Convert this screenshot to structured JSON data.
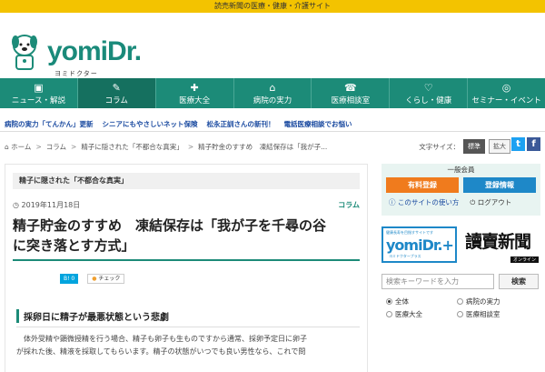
{
  "topbar": {
    "text": "読売新聞の医療・健康・介護サイト"
  },
  "logo": {
    "main": "yomi",
    "dr": "Dr.",
    "sub": "ヨミドクター"
  },
  "nav": [
    {
      "icon": "▣",
      "label": "ニュース・解説"
    },
    {
      "icon": "✎",
      "label": "コラム"
    },
    {
      "icon": "✚",
      "label": "医療大全"
    },
    {
      "icon": "⌂",
      "label": "病院の実力"
    },
    {
      "icon": "☎",
      "label": "医療相談室"
    },
    {
      "icon": "♡",
      "label": "くらし・健康"
    },
    {
      "icon": "◎",
      "label": "セミナー・イベント"
    }
  ],
  "subnav": [
    "病院の実力「てんかん」更新",
    "シニアにもやさしいネット保険",
    "松永正訓さんの新刊！",
    "電話医療相談でお悩い"
  ],
  "breadcrumb": [
    "ホーム",
    "コラム",
    "精子に隠された「不都合な真実」",
    "精子貯金のすすめ　凍結保存は「我が子..."
  ],
  "fontsize": {
    "label": "文字サイズ：",
    "standard": "標準",
    "large": "拡大"
  },
  "article": {
    "series": "精子に隠された「不都合な真実」",
    "date": "2019年11月18日",
    "category": "コラム",
    "title_line1": "精子貯金のすすめ　凍結保存は「我が子を千尋の谷",
    "title_line2": "に突き落とす方式」",
    "share_b": "B! 0",
    "share_check": "チェック",
    "h2": "採卵日に精子が最悪状態という悲劇",
    "body_line1": "体外受精や顕微授精を行う場合、精子も卵子も生ものですから通常、採卵予定日に卵子",
    "body_line2": "が採れた後、精液を採取してもらいます。精子の状態がいつでも良い男性なら、これで問"
  },
  "sidebar": {
    "member_title": "一般会員",
    "register": "有料登録",
    "info": "登録情報",
    "howto": "このサイトの使い方",
    "logout": "ログアウト",
    "banner_plus_small": "健康長寿を目指すサイトです",
    "banner_plus": "yomiDr.+",
    "banner_plus_sub": "ヨミドクタープラス",
    "banner_yomiuri": "讀賣新聞",
    "banner_yomiuri_online": "オンライン",
    "search_placeholder": "検索キーワードを入力",
    "search_button": "検索",
    "radios": [
      "全体",
      "病院の実力",
      "医療大全",
      "医療相談室"
    ]
  }
}
